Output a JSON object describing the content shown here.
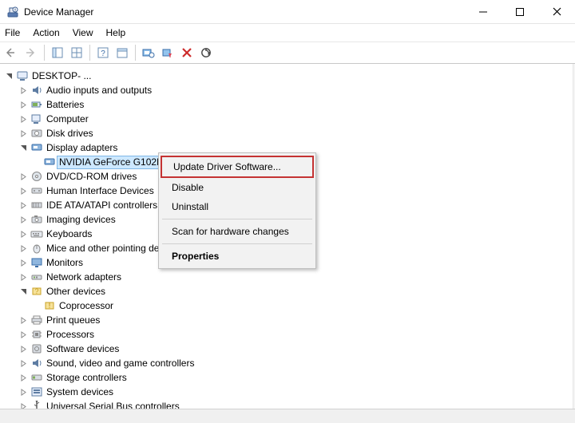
{
  "window": {
    "title": "Device Manager"
  },
  "menubar": [
    "File",
    "Action",
    "View",
    "Help"
  ],
  "tree": {
    "root": "DESKTOP- ...",
    "items": [
      "Audio inputs and outputs",
      "Batteries",
      "Computer",
      "Disk drives",
      "Display adapters",
      "NVIDIA GeForce G102M",
      "DVD/CD-ROM drives",
      "Human Interface Devices",
      "IDE ATA/ATAPI controllers",
      "Imaging devices",
      "Keyboards",
      "Mice and other pointing devices",
      "Monitors",
      "Network adapters",
      "Other devices",
      "Coprocessor",
      "Print queues",
      "Processors",
      "Software devices",
      "Sound, video and game controllers",
      "Storage controllers",
      "System devices",
      "Universal Serial Bus controllers"
    ]
  },
  "contextmenu": {
    "update": "Update Driver Software...",
    "disable": "Disable",
    "uninstall": "Uninstall",
    "scan": "Scan for hardware changes",
    "properties": "Properties"
  }
}
